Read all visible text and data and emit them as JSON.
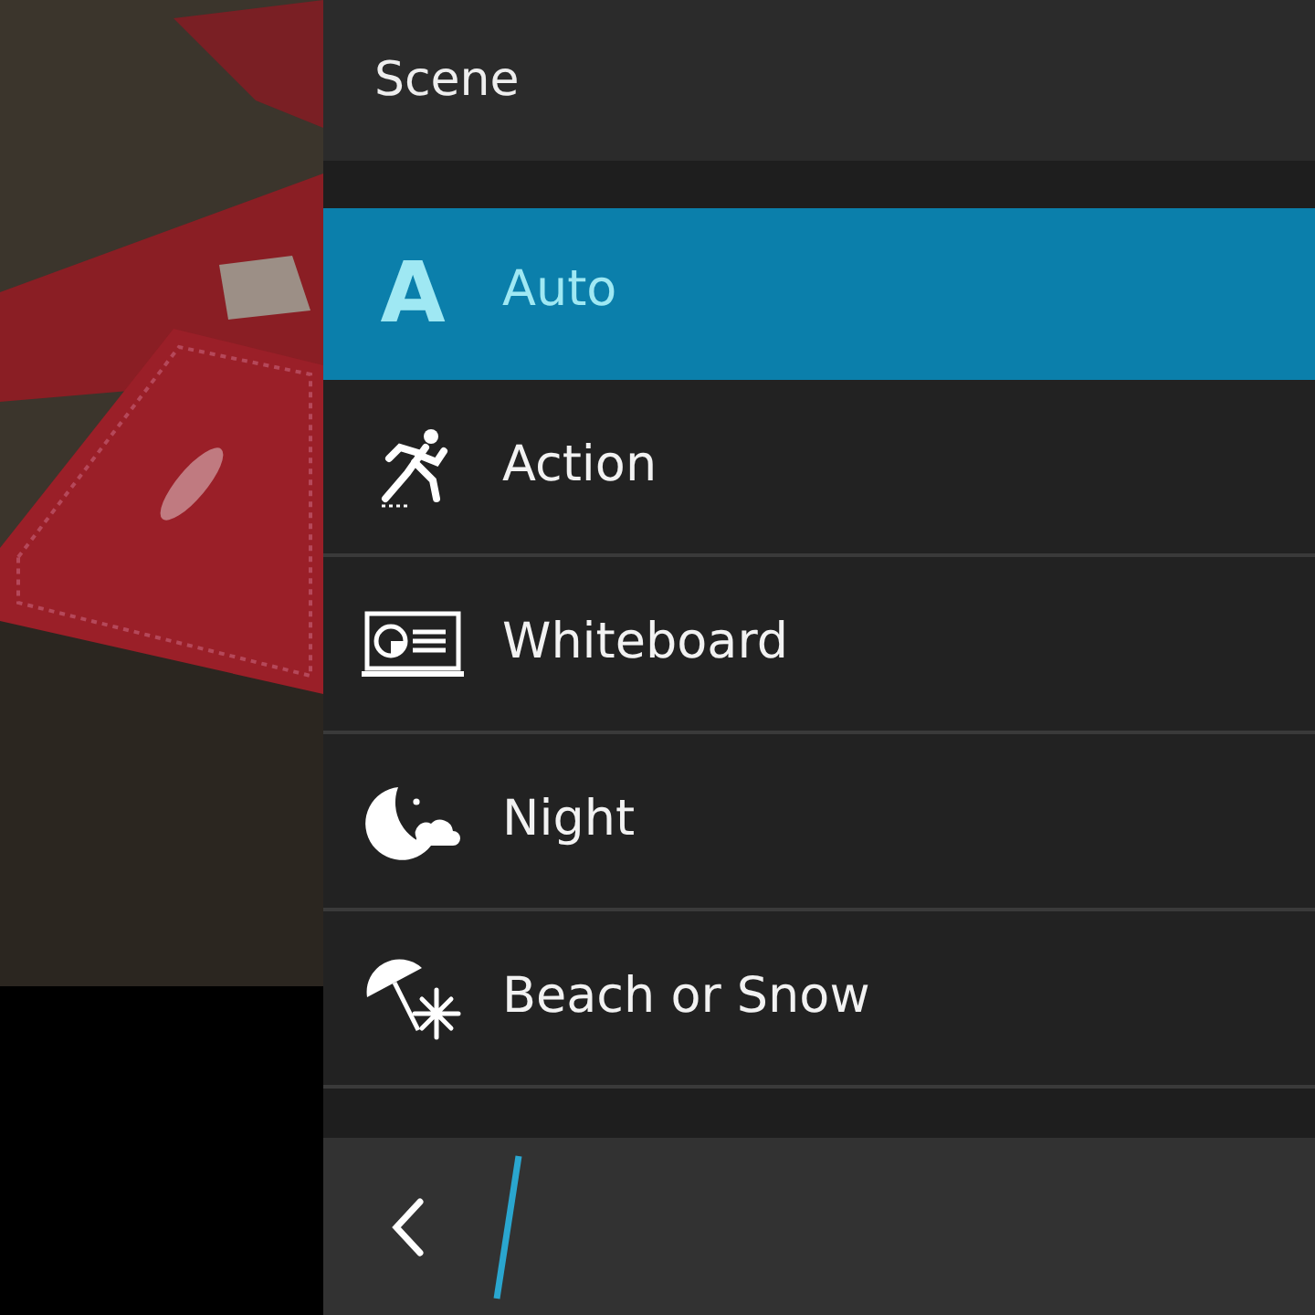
{
  "header": {
    "title": "Scene"
  },
  "scenes": [
    {
      "kind": "auto",
      "icon_text": "A",
      "label": "Auto",
      "selected": true
    },
    {
      "kind": "action",
      "label": "Action",
      "selected": false
    },
    {
      "kind": "whiteboard",
      "label": "Whiteboard",
      "selected": false
    },
    {
      "kind": "night",
      "label": "Night",
      "selected": false
    },
    {
      "kind": "beach_snow",
      "label": "Beach or Snow",
      "selected": false
    }
  ]
}
